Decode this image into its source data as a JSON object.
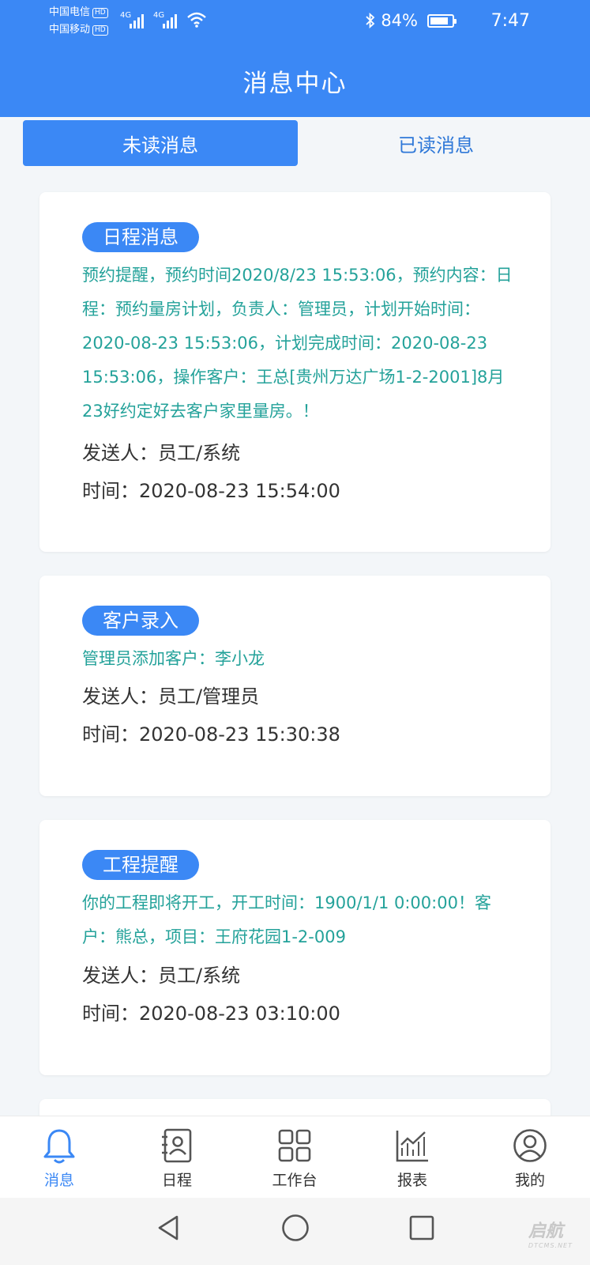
{
  "status_bar": {
    "carrier1": "中国电信",
    "carrier2": "中国移动",
    "hd_label": "HD",
    "network": "4G",
    "battery_text": "84%",
    "battery_level": 0.84,
    "time": "7:47"
  },
  "header": {
    "title": "消息中心"
  },
  "tabs": {
    "unread": "未读消息",
    "read": "已读消息"
  },
  "messages": [
    {
      "category": "日程消息",
      "content": "预约提醒，预约时间2020/8/23 15:53:06，预约内容：日程：预约量房计划，负责人：管理员，计划开始时间：2020-08-23 15:53:06，计划完成时间：2020-08-23 15:53:06，操作客户：王总[贵州万达广场1-2-2001]8月23好约定好去客户家里量房。！",
      "sender": "发送人：员工/系统",
      "time": "时间：2020-08-23 15:54:00"
    },
    {
      "category": "客户录入",
      "content": "管理员添加客户：李小龙",
      "sender": "发送人：员工/管理员",
      "time": "时间：2020-08-23 15:30:38"
    },
    {
      "category": "工程提醒",
      "content": "你的工程即将开工，开工时间：1900/1/1 0:00:00！客户：熊总，项目：王府花园1-2-009",
      "sender": "发送人：员工/系统",
      "time": "时间：2020-08-23 03:10:00"
    }
  ],
  "tabbar": [
    {
      "label": "消息",
      "icon": "bell-icon"
    },
    {
      "label": "日程",
      "icon": "contact-book-icon"
    },
    {
      "label": "工作台",
      "icon": "grid-icon"
    },
    {
      "label": "报表",
      "icon": "chart-icon"
    },
    {
      "label": "我的",
      "icon": "user-icon"
    }
  ],
  "colors": {
    "primary": "#3b88f5",
    "content_text": "#24a29a",
    "background": "#f3f6f9"
  },
  "watermark": {
    "text": "启航",
    "subtext": "DTCMS.NET"
  }
}
